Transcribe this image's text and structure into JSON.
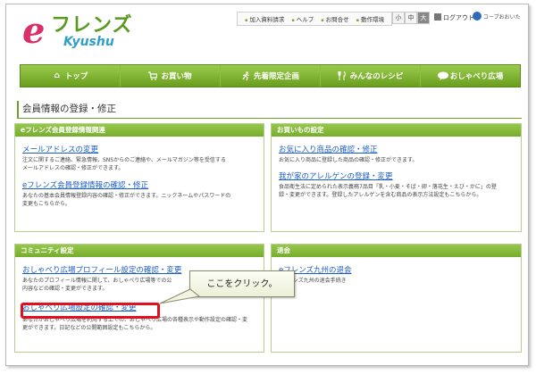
{
  "header": {
    "logo_e": "e",
    "logo_main": "フレンズ",
    "logo_sub": "Kyushu",
    "top_links": [
      "加入資料請求",
      "ヘルプ",
      "お問合せ",
      "動作環境"
    ],
    "font_sizes": [
      "小",
      "中",
      "大"
    ],
    "logout_label": "ログアウト",
    "coop_label": "コープおおいた"
  },
  "nav": {
    "items": [
      {
        "label": "トップ",
        "icon": "home-icon"
      },
      {
        "label": "お買い物",
        "icon": "cart-icon"
      },
      {
        "label": "先着限定企画",
        "icon": "runner-icon"
      },
      {
        "label": "みんなのレシピ",
        "icon": "cutlery-icon"
      },
      {
        "label": "おしゃべり広場",
        "icon": "chat-bubble-icon"
      }
    ]
  },
  "page_title": "会員情報の登録・修正",
  "panels": {
    "member": {
      "title": "eフレンズ会員登録情報関連",
      "entries": [
        {
          "link": "メールアドレスの変更",
          "desc1": "注文に関するご連絡、緊急情報、SNSからのご連絡や、メールマガジン等を受信する",
          "desc2": "メールアドレスの確認・修正ができます。"
        },
        {
          "link": "eフレンズ会員登録情報の確認・修正",
          "desc1": "あなたの基本会員情報登録内容の確認・修正ができます。ニックネームやパスワードの",
          "desc2": "変更もこちらから。"
        }
      ]
    },
    "shopping": {
      "title": "お買いもの設定",
      "entries": [
        {
          "link": "お気に入り商品の確認・修正",
          "desc1": "お気に入り商品に登録した商品の確認・修正ができます。",
          "desc2": ""
        },
        {
          "link": "我が家のアレルゲンの登録・変更",
          "desc1": "食品衛生法に定められた表示義務7品目「乳・小麦・そば・卵・落花生・えび・かに」の登",
          "desc2": "録・変更ができます。登録したアレルゲンを含む商品の表示方法設定もこちらから。"
        }
      ]
    },
    "community": {
      "title": "コミュニティ設定",
      "entries": [
        {
          "link": "おしゃべり広場プロフィール設定の確認・変更",
          "desc1": "あなたのプロフィール情報に関して、おしゃべり広場等での公",
          "desc2": "内容などの確認・変更ができます。"
        },
        {
          "link": "おしゃべり広場設定の確認・変更",
          "desc1": "あなたがおしゃべり広場を利用する上での、おしゃべり広場の各種表示や動作設定の確認・変",
          "desc2": "更ができます。日記などの公開範囲設定もこちらから。"
        }
      ]
    },
    "withdraw": {
      "title": "退会",
      "entries": [
        {
          "link": "eフレンズ九州の退会",
          "desc1": "eフレンズ九州の退会手続き",
          "desc2": ""
        }
      ]
    }
  },
  "callout": {
    "text": "ここをクリック。"
  },
  "colors": {
    "brand_green": "#77ad2c",
    "link_blue": "#1a5cc8",
    "highlight_red": "#e0101e",
    "logo_pink": "#d9306a"
  }
}
